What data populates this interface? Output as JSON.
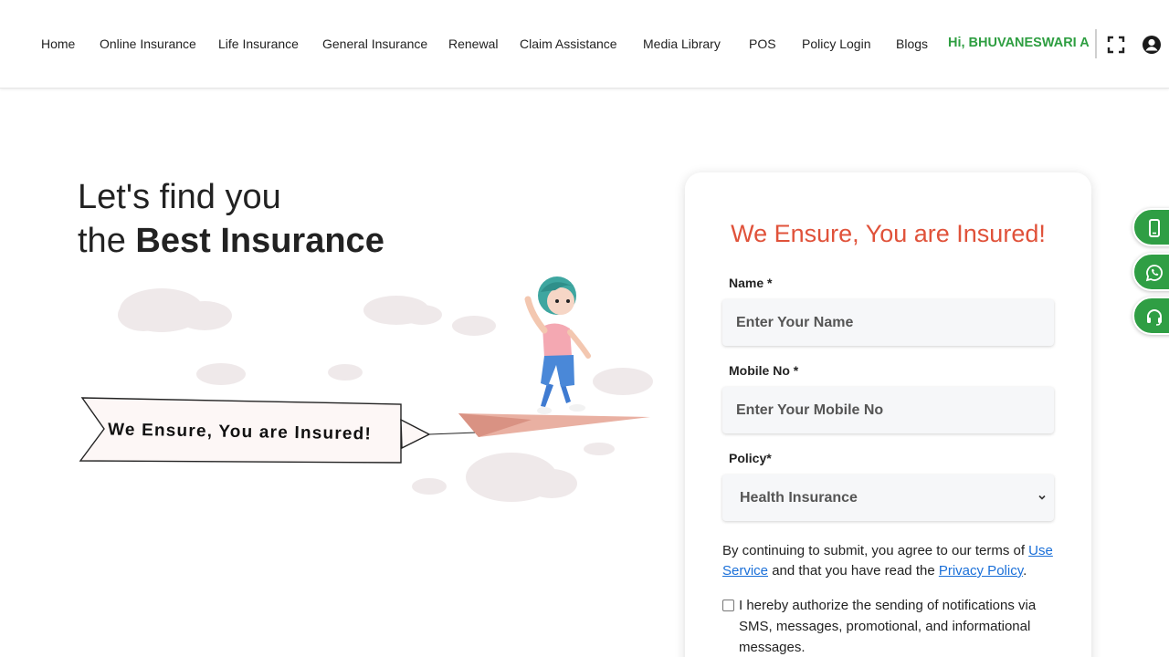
{
  "nav": {
    "items": [
      {
        "label": "Home"
      },
      {
        "label": "Online Insurance"
      },
      {
        "label": "Life Insurance"
      },
      {
        "label": "General Insurance"
      },
      {
        "label": "Renewal"
      },
      {
        "label": "Claim Assistance"
      },
      {
        "label": "Media Library"
      },
      {
        "label": "POS"
      },
      {
        "label": "Policy Login"
      },
      {
        "label": "Blogs"
      }
    ],
    "greeting": "Hi, BHUVANESWARI A",
    "icons": [
      "fullscreen-icon",
      "user-account-icon"
    ]
  },
  "hero": {
    "title_line1": "Let's find you",
    "title_prefix": "the ",
    "title_bold": "Best Insurance",
    "banner_text": "We Ensure, You are Insured!"
  },
  "form": {
    "title": "We Ensure, You are Insured!",
    "name_label": "Name *",
    "name_placeholder": "Enter Your Name",
    "mobile_label": "Mobile No *",
    "mobile_placeholder": "Enter Your Mobile No",
    "policy_label": "Policy*",
    "policy_selected": "Health Insurance",
    "terms_prefix": "By continuing to submit, you agree to our terms of ",
    "terms_link": "Use Service",
    "terms_middle": " and that you have read the ",
    "privacy_link": "Privacy Policy",
    "terms_suffix": ".",
    "consent_text": "I hereby authorize the sending of notifications via SMS, messages, promotional, and informational messages.",
    "consent_checked": false
  },
  "side_buttons": [
    "mobile-phone-icon",
    "whatsapp-icon",
    "headset-support-icon"
  ],
  "colors": {
    "accent_green": "#2e9e41",
    "title_red": "#e0523a",
    "link_blue": "#1a6fd8"
  }
}
